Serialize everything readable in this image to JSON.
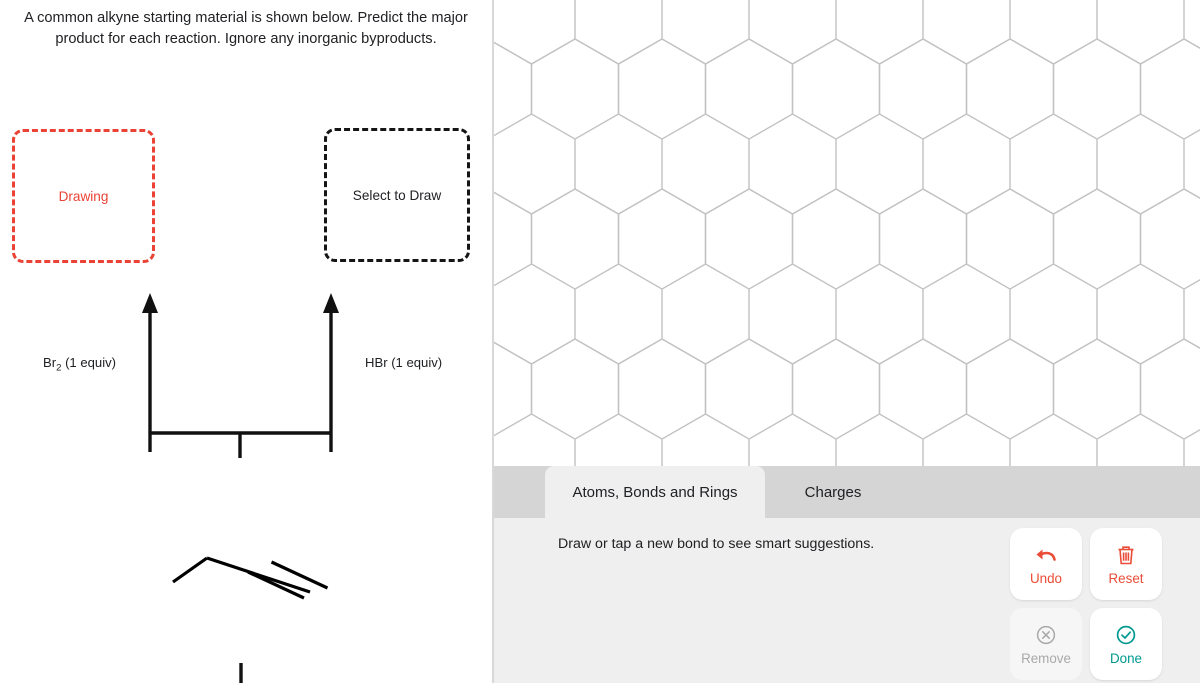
{
  "prompt": {
    "text": "A common alkyne starting material is shown below. Predict the major product for each reaction. Ignore any inorganic byproducts."
  },
  "answer_boxes": [
    {
      "id": "box-1",
      "label": "Drawing",
      "state": "active",
      "border_color": "#ea4335",
      "text_color": "#ea4335"
    },
    {
      "id": "box-2",
      "label": "Select to Draw",
      "state": "empty",
      "border_color": "#151515",
      "text_color": "#202124"
    }
  ],
  "reaction": {
    "left_reagent": "Br",
    "left_reagent_sub": "2",
    "left_reagent_rest": " (1 equiv)",
    "right_reagent": "HBr (1 equiv)",
    "arrow_color": "#111111",
    "structure_name": "alkyne-skeletal-structure",
    "bond_color": "#000000"
  },
  "editor": {
    "canvas_name": "hexagonal-grid-canvas",
    "grid_line_color": "#c2c2c2",
    "tabs": [
      {
        "label": "Atoms, Bonds and Rings",
        "active": true
      },
      {
        "label": "Charges",
        "active": false
      }
    ],
    "hint": "Draw or tap a new bond to see smart suggestions.",
    "actions": [
      {
        "label": "Undo",
        "icon": "undo-arrow-icon",
        "color": "#ea4c38",
        "enabled": true
      },
      {
        "label": "Reset",
        "icon": "trash-can-icon",
        "color": "#ea4c38",
        "enabled": true
      },
      {
        "label": "Remove",
        "icon": "remove-circle-icon",
        "color": "#a9a9a9",
        "enabled": false
      },
      {
        "label": "Done",
        "icon": "check-circle-icon",
        "color": "#00998f",
        "enabled": true
      }
    ]
  }
}
